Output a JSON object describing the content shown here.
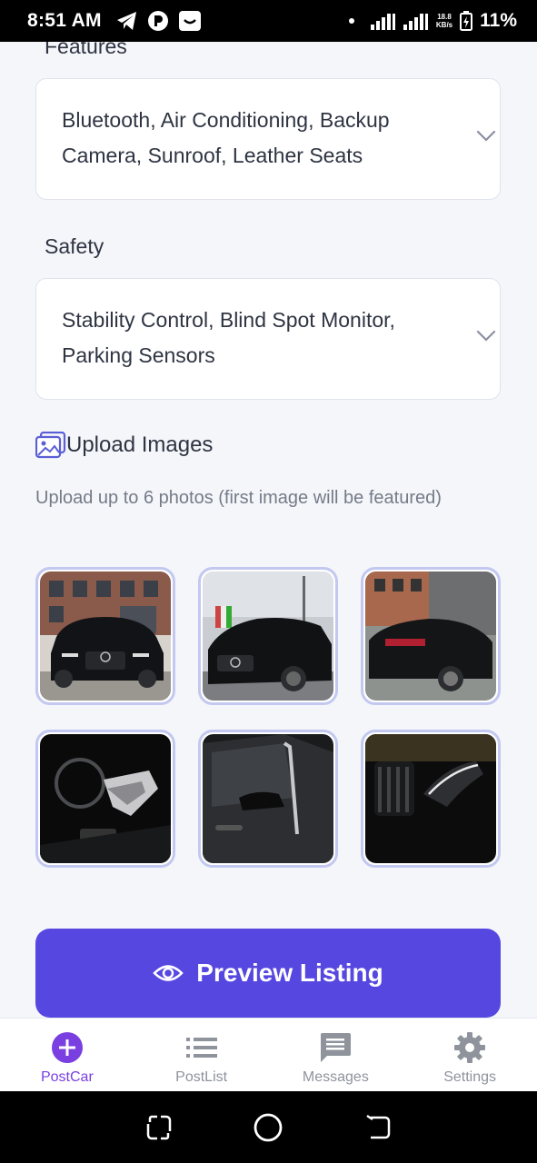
{
  "status_bar": {
    "time": "8:51 AM",
    "speed_top": "18.8",
    "speed_unit": "KB/s",
    "battery": "11%"
  },
  "features": {
    "label": "Features",
    "value": "Bluetooth, Air Conditioning, Backup Camera, Sunroof, Leather Seats"
  },
  "safety": {
    "label": "Safety",
    "value": "Stability Control, Blind Spot Monitor, Parking Sensors"
  },
  "upload": {
    "title": "Upload Images",
    "subtitle": "Upload up to 6 photos (first image will be featured)"
  },
  "preview_button": {
    "label": "Preview Listing"
  },
  "bottom_nav": {
    "items": [
      {
        "label": "PostCar",
        "icon": "plus-circle-icon",
        "active": true
      },
      {
        "label": "PostList",
        "icon": "list-icon",
        "active": false
      },
      {
        "label": "Messages",
        "icon": "chat-icon",
        "active": false
      },
      {
        "label": "Settings",
        "icon": "gear-icon",
        "active": false
      }
    ]
  },
  "colors": {
    "accent": "#5647e0",
    "active_nav": "#7a3fe0",
    "thumb_border": "#c3c8f0"
  }
}
